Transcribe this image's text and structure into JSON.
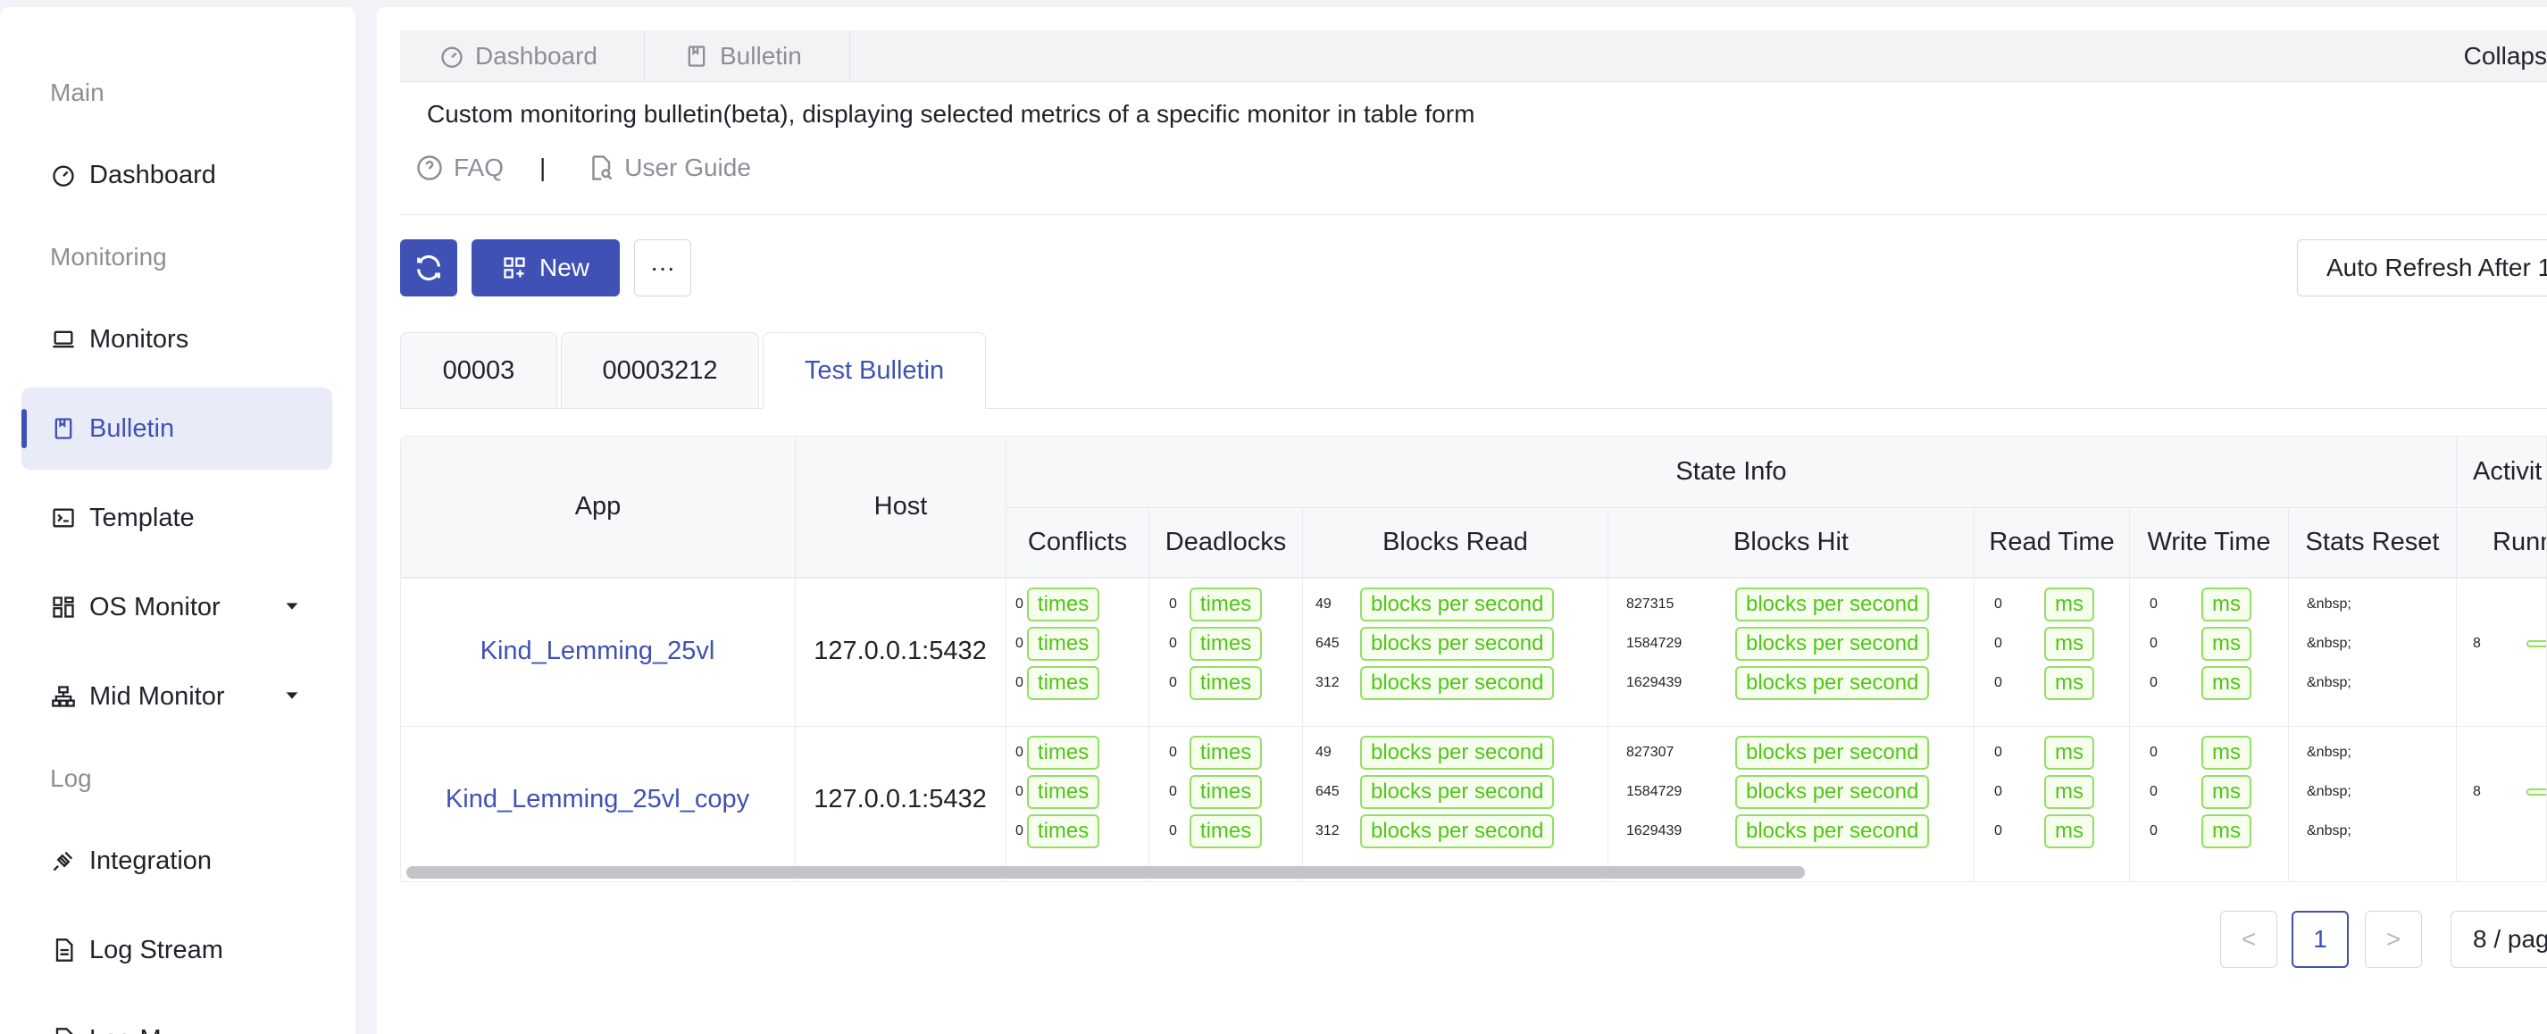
{
  "sidebar": {
    "groups": {
      "main": "Main",
      "monitoring": "Monitoring",
      "log": "Log"
    },
    "items": {
      "dashboard": "Dashboard",
      "monitors": "Monitors",
      "bulletin": "Bulletin",
      "template": "Template",
      "os_monitor": "OS Monitor",
      "mid_monitor": "Mid Monitor",
      "integration": "Integration",
      "log_stream": "Log Stream",
      "log_more": "Log M"
    },
    "active_item": "Bulletin",
    "accent_color": "#3f51b5"
  },
  "page_tabs": [
    "Dashboard",
    "Bulletin"
  ],
  "collapse_label": "Collaps",
  "description": "Custom monitoring bulletin(beta), displaying selected metrics of a specific monitor in table form",
  "links": {
    "faq": "FAQ",
    "separator": "|",
    "guide": "User Guide"
  },
  "toolbar": {
    "new_label": "New",
    "more_label": "···",
    "auto_refresh": "Auto Refresh After 1"
  },
  "bulletin_tabs": [
    "00003",
    "00003212",
    "Test Bulletin"
  ],
  "active_bulletin_tab": "Test Bulletin",
  "table": {
    "group_headers": {
      "state_info": "State Info",
      "activity": "Activit"
    },
    "headers": {
      "app": "App",
      "host": "Host",
      "conflicts": "Conflicts",
      "deadlocks": "Deadlocks",
      "blocks_read": "Blocks Read",
      "blocks_hit": "Blocks Hit",
      "read_time": "Read Time",
      "write_time": "Write Time",
      "stats_reset": "Stats Reset",
      "running": "Runn"
    },
    "units": {
      "times": "times",
      "bps": "blocks per second",
      "ms": "ms"
    },
    "rows": [
      {
        "app": "Kind_Lemming_25vl",
        "host": "127.0.0.1:5432",
        "conflicts": [
          "0",
          "0",
          "0"
        ],
        "deadlocks": [
          "0",
          "0",
          "0"
        ],
        "blocks_read": [
          "49",
          "645",
          "312"
        ],
        "blocks_hit": [
          "827315",
          "1584729",
          "1629439"
        ],
        "read_time": [
          "0",
          "0",
          "0"
        ],
        "write_time": [
          "0",
          "0",
          "0"
        ],
        "stats_reset": [
          "&nbsp;",
          "&nbsp;",
          "&nbsp;"
        ],
        "running": "8"
      },
      {
        "app": "Kind_Lemming_25vl_copy",
        "host": "127.0.0.1:5432",
        "conflicts": [
          "0",
          "0",
          "0"
        ],
        "deadlocks": [
          "0",
          "0",
          "0"
        ],
        "blocks_read": [
          "49",
          "645",
          "312"
        ],
        "blocks_hit": [
          "827307",
          "1584729",
          "1629439"
        ],
        "read_time": [
          "0",
          "0",
          "0"
        ],
        "write_time": [
          "0",
          "0",
          "0"
        ],
        "stats_reset": [
          "&nbsp;",
          "&nbsp;",
          "&nbsp;"
        ],
        "running": "8"
      }
    ]
  },
  "pagination": {
    "prev": "<",
    "page": "1",
    "next": ">",
    "size": "8 / pag"
  }
}
